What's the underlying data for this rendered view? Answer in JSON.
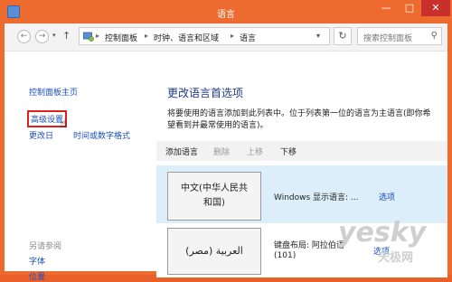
{
  "window": {
    "title": "语言",
    "buttons": {
      "minimize": "—",
      "maximize": "□",
      "close": "✕"
    }
  },
  "address_bar": {
    "breadcrumb": [
      "控制面板",
      "时钟、语言和区域",
      "语言"
    ],
    "separator": "▸",
    "search_placeholder": "搜索控制面板",
    "refresh_glyph": "↻",
    "dropdown_glyph": "▾"
  },
  "nav": {
    "back": "←",
    "forward": "→",
    "recent": "▾",
    "up": "↑"
  },
  "sidebar": {
    "home": "控制面板主页",
    "advanced": "高级设置",
    "change_date_prefix": "更改日",
    "change_date_suffix": "时间或数字格式",
    "see_also": "另请参阅",
    "fonts": "字体",
    "location": "位置"
  },
  "main": {
    "heading": "更改语言首选项",
    "description": "将要使用的语言添加到此列表中。位于列表第一位的语言为主语言(即你希望看到并最常使用的语言)。",
    "toolbar": {
      "add": "添加语言",
      "delete": "删除",
      "up": "上移",
      "down": "下移"
    },
    "languages": [
      {
        "tile_line1": "中文(中华人民共",
        "tile_line2": "和国)",
        "info": "Windows 显示语言: ...",
        "link": "选项"
      },
      {
        "tile": "العربية (مصر)",
        "info_line1": "键盘布局: 阿拉伯语",
        "info_line2": "(101)",
        "link": "选项"
      }
    ]
  },
  "watermark": {
    "brand": "yesky",
    "sub": "天极网"
  },
  "colors": {
    "accent": "#ee6b2f",
    "link": "#1a4dbd",
    "selection": "#dbeefa",
    "highlight_box": "#e02020"
  },
  "icons": [
    "app-icon",
    "control-panel-icon",
    "search-icon",
    "refresh-icon",
    "cursor-icon"
  ]
}
